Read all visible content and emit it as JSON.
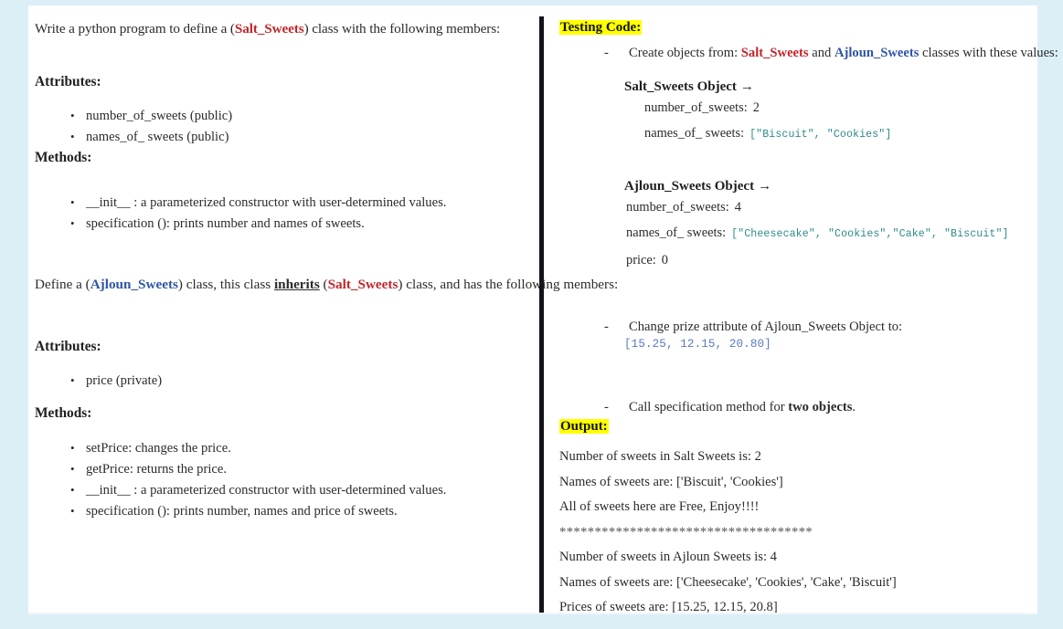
{
  "document": {
    "left_column": {
      "intro": {
        "before": "Write a python program to define a (",
        "class_name": "Salt_Sweets",
        "after": ") class with the following members:"
      },
      "attributes_heading_1": "Attributes:",
      "attributes_1": [
        "number_of_sweets (public)",
        "names_of_ sweets (public)"
      ],
      "methods_heading_1": "Methods:",
      "methods_1": [
        "__init__ : a parameterized constructor with user-determined values.",
        "specification (): prints number and names of sweets."
      ],
      "define_line": {
        "part1": "Define a (",
        "class_child": "Ajloun_Sweets",
        "part2": ") class, this class ",
        "inherits": "inherits",
        "part3": " (",
        "class_parent": "Salt_Sweets",
        "part4": ") class, and has the following members:"
      },
      "attributes_heading_2": "Attributes:",
      "attributes_2": [
        "price (private)"
      ],
      "methods_heading_2": "Methods:",
      "methods_2": [
        "setPrice: changes the price.",
        "getPrice: returns the price.",
        "__init__ : a parameterized constructor with user-determined values.",
        "specification (): prints number, names and price of sweets."
      ]
    },
    "right_column": {
      "testing_code_heading": "Testing Code:",
      "create_objects": {
        "prefix": "Create objects from: ",
        "class_a": "Salt_Sweets",
        "conjunction": " and ",
        "class_b": "Ajloun_Sweets",
        "suffix": " classes with these values:"
      },
      "object_salt": {
        "title": "Salt_Sweets Object",
        "arrow": "→",
        "rows": [
          {
            "key": "number_of_sweets:",
            "value": "2",
            "style": "plain"
          },
          {
            "key": "names_of_ sweets:",
            "value": "[\"Biscuit\", \"Cookies\"]",
            "style": "mono-teal"
          }
        ]
      },
      "object_ajloun": {
        "title": "Ajloun_Sweets Object",
        "arrow": "→",
        "rows": [
          {
            "key": "number_of_sweets:",
            "value": "4",
            "style": "plain"
          },
          {
            "key": "names_of_ sweets:",
            "value": "[\"Cheesecake\", \"Cookies\",\"Cake\", \"Biscuit\"]",
            "style": "mono-teal"
          },
          {
            "key": "price:",
            "value": "0",
            "style": "plain"
          }
        ]
      },
      "change_prize_line": "Change prize attribute of Ajloun_Sweets Object to:",
      "prices_value": "[15.25, 12.15, 20.80]",
      "call_spec": {
        "prefix": "Call specification method for ",
        "bold": "two objects",
        "suffix": "."
      },
      "output_heading": "Output:",
      "output_lines": [
        "Number of sweets in Salt Sweets is: 2",
        "Names of sweets are: ['Biscuit', 'Cookies']",
        "All of sweets here are Free, Enjoy!!!!",
        "************************************",
        "Number of sweets in Ajloun Sweets is: 4",
        "Names of sweets are: ['Cheesecake', 'Cookies', 'Cake', 'Biscuit']",
        "Prices of sweets are: [15.25, 12.15, 20.8]"
      ]
    }
  },
  "colors": {
    "page_background": "#dceff7",
    "paper": "#ffffff",
    "highlight": "#ffff00",
    "class_red": "#c2252b",
    "class_blue": "#2f55a4",
    "code_teal": "#2e8a8a",
    "code_blue": "#5b79c0",
    "divider": "#111418"
  }
}
